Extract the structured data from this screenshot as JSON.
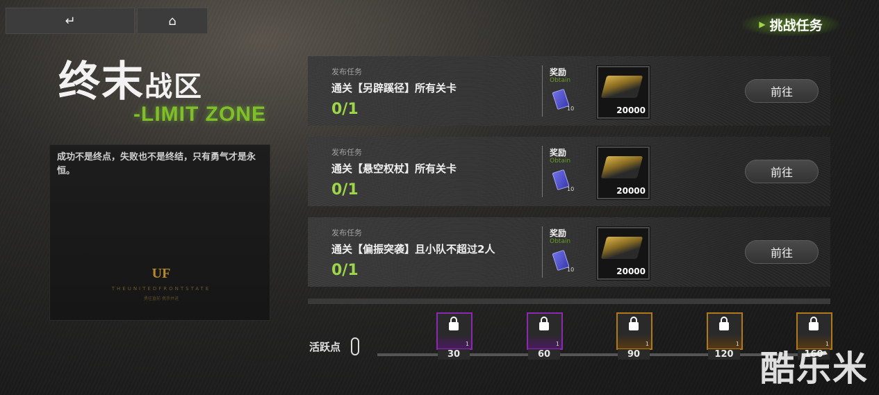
{
  "nav": {
    "back_icon": "back-arrow-icon",
    "home_icon": "home-icon"
  },
  "challenge": {
    "label": "挑战任务"
  },
  "title": {
    "cn_big": "终末",
    "cn_small": "战区",
    "en": "-LIMIT ZONE"
  },
  "description": "成功不是终点，失败也不是终结，只有勇气才是永恒。",
  "logo": {
    "text": "UF",
    "sub1": "THEUNITEDFRONTSTATE",
    "sub2": "勇往直前 携手并进"
  },
  "tasks": [
    {
      "label": "发布任务",
      "name": "通关【另辟蹊径】所有关卡",
      "progress": "0/1",
      "reward_label": "奖励",
      "obtain": "Obtain",
      "ticket_count": "10",
      "item_qty": "20000",
      "go": "前往"
    },
    {
      "label": "发布任务",
      "name": "通关【悬空权杖】所有关卡",
      "progress": "0/1",
      "reward_label": "奖励",
      "obtain": "Obtain",
      "ticket_count": "10",
      "item_qty": "20000",
      "go": "前往"
    },
    {
      "label": "发布任务",
      "name": "通关【偏振突袭】且小队不超过2人",
      "progress": "0/1",
      "reward_label": "奖励",
      "obtain": "Obtain",
      "ticket_count": "10",
      "item_qty": "20000",
      "go": "前往"
    }
  ],
  "activity": {
    "label": "活跃点",
    "milestones": [
      {
        "value": "30",
        "count": "1",
        "tier": "purple"
      },
      {
        "value": "60",
        "count": "1",
        "tier": "purple"
      },
      {
        "value": "90",
        "count": "1",
        "tier": "gold"
      },
      {
        "value": "120",
        "count": "1",
        "tier": "gold"
      },
      {
        "value": "160",
        "count": "1",
        "tier": "gold"
      }
    ]
  },
  "watermark": "酷乐米",
  "colors": {
    "accent_green": "#9ed64a",
    "purple": "#8a2ab0",
    "gold": "#b07a1a"
  }
}
